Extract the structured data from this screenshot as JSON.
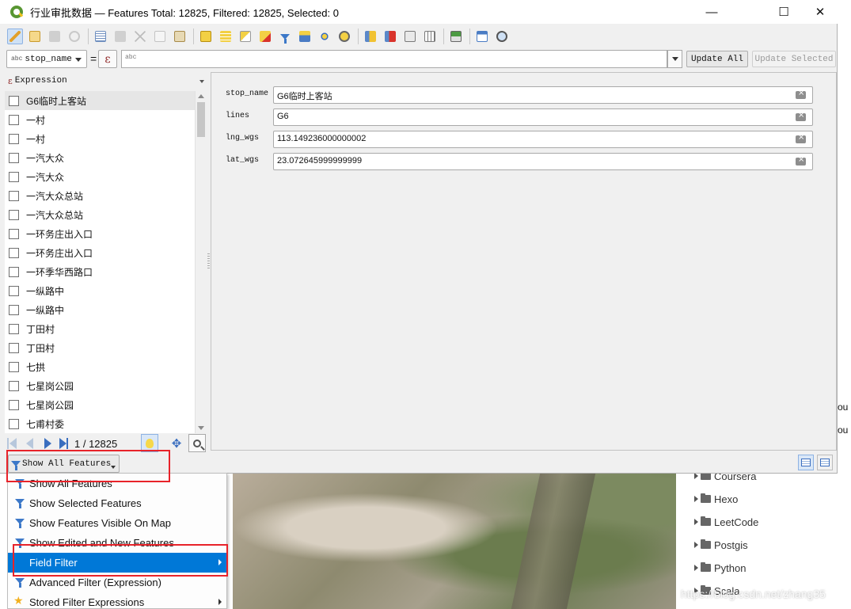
{
  "window": {
    "title": "行业审批数据 — Features Total: 12825, Filtered: 12825, Selected: 0",
    "controls": {
      "minimize": "—",
      "maximize": "☐",
      "close": "✕"
    }
  },
  "toolbar": {
    "icons": [
      "pencil-icon",
      "multi-edit-icon",
      "save-icon",
      "reload-icon",
      "add-feature-icon",
      "delete-feature-icon",
      "cut-icon",
      "copy-icon",
      "paste-icon",
      "select-expression-icon",
      "select-all-icon",
      "invert-selection-icon",
      "deselect-icon",
      "filter-selected-icon",
      "move-top-icon",
      "pan-to-icon",
      "zoom-to-icon",
      "new-field-icon",
      "delete-field-icon",
      "field-calculator-icon",
      "conditional-format-icon",
      "actions-icon",
      "dock-icon",
      "map-tips-icon"
    ]
  },
  "expression_bar": {
    "field_badge": "abc",
    "field": "stop_name",
    "equals": "=",
    "epsilon": "ε",
    "value_placeholder": "abc",
    "update_all": "Update All",
    "update_selected": "Update Selected"
  },
  "list_panel": {
    "header_icon": "ε",
    "header": "Expression",
    "items": [
      "G6临时上客站",
      "一村",
      "一村",
      "一汽大众",
      "一汽大众",
      "一汽大众总站",
      "一汽大众总站",
      "一环务庄出入口",
      "一环务庄出入口",
      "一环季华西路口",
      "一纵路中",
      "一纵路中",
      "丁田村",
      "丁田村",
      "七拱",
      "七星岗公园",
      "七星岗公园",
      "七甫村委"
    ],
    "page_indicator": "1 / 12825"
  },
  "form": {
    "fields": [
      {
        "label": "stop_name",
        "value": "G6临时上客站"
      },
      {
        "label": "lines",
        "value": "G6"
      },
      {
        "label": "lng_wgs",
        "value": "113.149236000000002"
      },
      {
        "label": "lat_wgs",
        "value": "23.072645999999999"
      }
    ]
  },
  "filter_button": {
    "label": "Show All Features"
  },
  "menu": {
    "items": [
      {
        "label": "Show All Features",
        "icon": "funnel-icon",
        "submenu": false,
        "highlighted": false
      },
      {
        "label": "Show Selected Features",
        "icon": "funnel-icon",
        "submenu": false,
        "highlighted": false
      },
      {
        "label": "Show Features Visible On Map",
        "icon": "funnel-icon",
        "submenu": false,
        "highlighted": false
      },
      {
        "label": "Show Edited and New Features",
        "icon": "funnel-icon",
        "submenu": false,
        "highlighted": false
      },
      {
        "label": "Field Filter",
        "icon": "",
        "submenu": true,
        "highlighted": true
      },
      {
        "label": "Advanced Filter (Expression)",
        "icon": "funnel-icon",
        "submenu": false,
        "highlighted": false
      },
      {
        "label": "Stored Filter Expressions",
        "icon": "star-icon",
        "submenu": true,
        "highlighted": false
      }
    ]
  },
  "background": {
    "folders": [
      "Coursera",
      "Hexo",
      "LeetCode",
      "Postgis",
      "Python",
      "Scala"
    ],
    "right_edge_text": [
      "ou",
      "ou"
    ],
    "watermark": "https://blog.csdn.net/zhang35"
  },
  "colors": {
    "highlight": "#0078d7",
    "annotation_box": "#e8232a",
    "qgis_green": "#589632"
  }
}
